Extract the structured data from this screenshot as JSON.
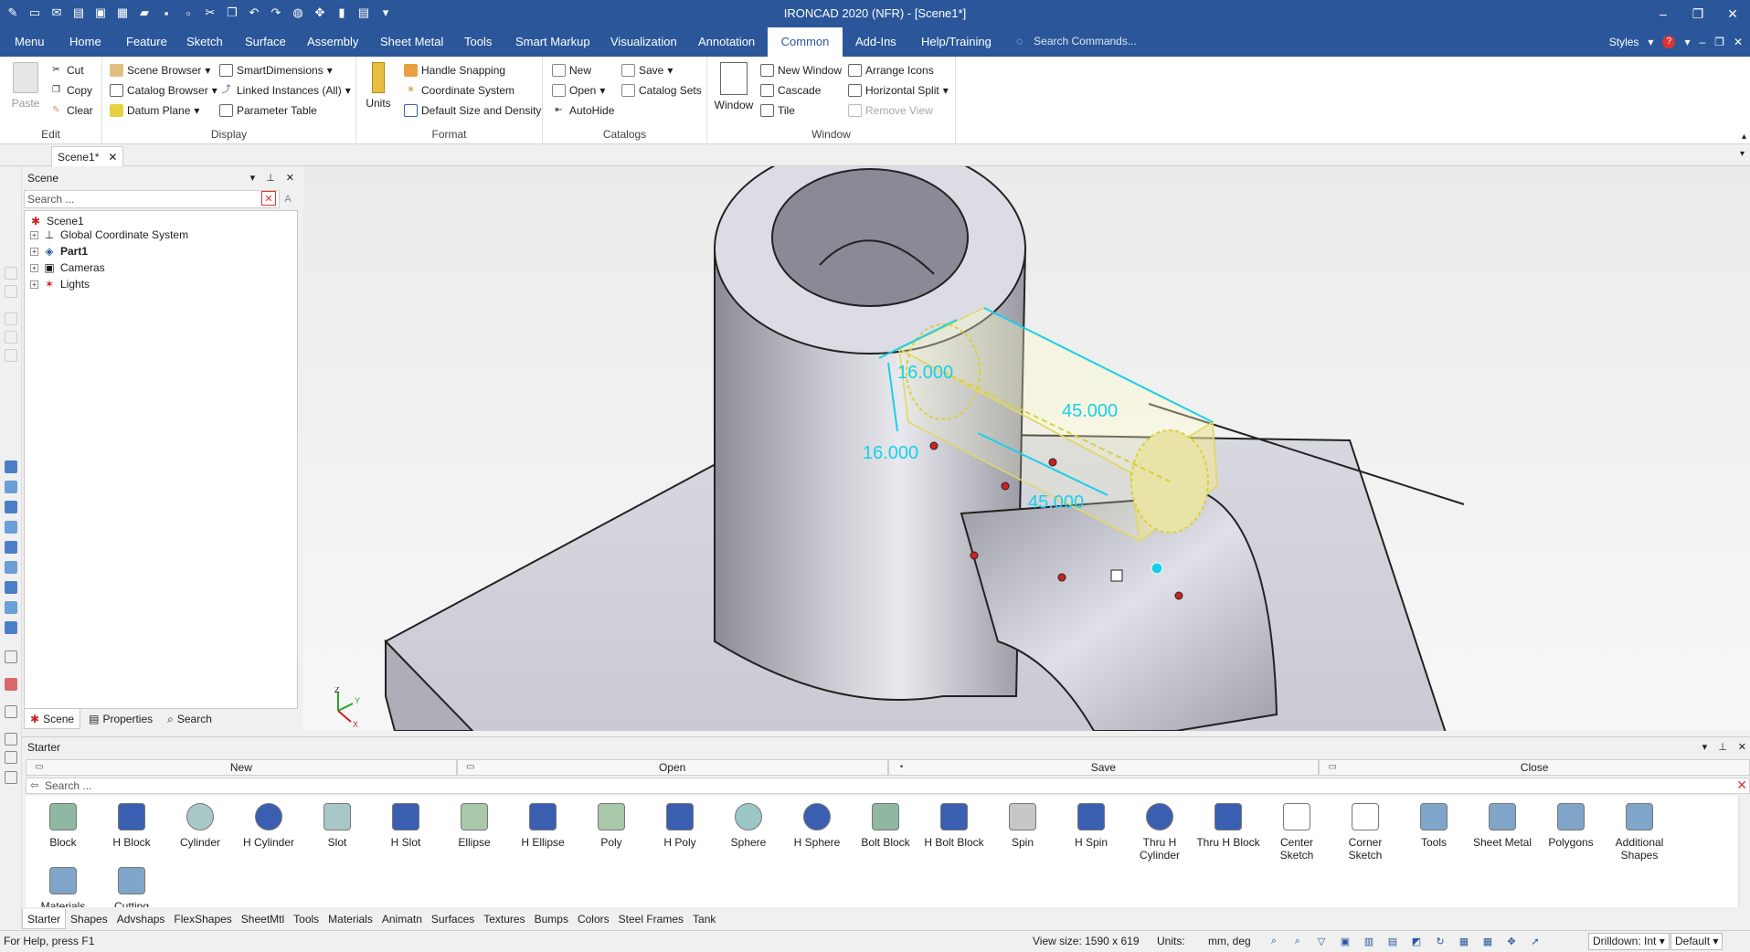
{
  "window": {
    "title": "IRONCAD 2020 (NFR) - [Scene1*]"
  },
  "ribbon_tabs": [
    "Menu",
    "Home",
    "Feature",
    "Sketch",
    "Surface",
    "Assembly",
    "Sheet Metal",
    "Tools",
    "Smart Markup",
    "Visualization",
    "Annotation",
    "Common",
    "Add-Ins",
    "Help/Training"
  ],
  "active_tab": "Common",
  "command_search_placeholder": "Search Commands...",
  "styles_label": "Styles",
  "ribbon": {
    "edit": {
      "title": "Edit",
      "paste": "Paste",
      "cut": "Cut",
      "copy": "Copy",
      "clear": "Clear"
    },
    "display": {
      "title": "Display",
      "scene_browser": "Scene Browser",
      "catalog_browser": "Catalog Browser",
      "datum_plane": "Datum Plane",
      "smart_dimensions": "SmartDimensions",
      "linked_instances": "Linked Instances (All)",
      "parameter_table": "Parameter Table"
    },
    "format": {
      "title": "Format",
      "units": "Units",
      "handle_snapping": "Handle Snapping",
      "coordinate_system": "Coordinate System",
      "default_size": "Default Size and Density"
    },
    "catalogs": {
      "title": "Catalogs",
      "new": "New",
      "open": "Open",
      "autohide": "AutoHide",
      "save": "Save",
      "catalog_sets": "Catalog Sets"
    },
    "window": {
      "title": "Window",
      "window": "Window",
      "new_window": "New Window",
      "cascade": "Cascade",
      "tile": "Tile",
      "arrange_icons": "Arrange Icons",
      "horizontal_split": "Horizontal Split",
      "remove_view": "Remove View"
    }
  },
  "doc_tab": "Scene1*",
  "scene_panel": {
    "title": "Scene",
    "search_placeholder": "Search ...",
    "tree": [
      {
        "label": "Scene1",
        "bold": false
      },
      {
        "label": "Global Coordinate System",
        "bold": false
      },
      {
        "label": "Part1",
        "bold": true
      },
      {
        "label": "Cameras",
        "bold": false
      },
      {
        "label": "Lights",
        "bold": false
      }
    ],
    "tabs": [
      "Scene",
      "Properties",
      "Search"
    ]
  },
  "viewport": {
    "dimensions": [
      "16.000",
      "45.000",
      "16.000",
      "45.000"
    ],
    "triad_labels": [
      "Z",
      "Y",
      "X"
    ]
  },
  "catalog": {
    "title": "Starter",
    "buttons": [
      "New",
      "Open",
      "Save",
      "Close"
    ],
    "search_placeholder": "Search ...",
    "items": [
      {
        "label": "Block",
        "color": "#8fb8a2"
      },
      {
        "label": "H Block",
        "color": "#3b5fb0"
      },
      {
        "label": "Cylinder",
        "color": "#a9c7c7"
      },
      {
        "label": "H Cylinder",
        "color": "#3b5fb0"
      },
      {
        "label": "Slot",
        "color": "#a9c7c7"
      },
      {
        "label": "H Slot",
        "color": "#3b5fb0"
      },
      {
        "label": "Ellipse",
        "color": "#a9c7a9"
      },
      {
        "label": "H Ellipse",
        "color": "#3b5fb0"
      },
      {
        "label": "Poly",
        "color": "#a9c7a9"
      },
      {
        "label": "H Poly",
        "color": "#3b5fb0"
      },
      {
        "label": "Sphere",
        "color": "#9cc7c7"
      },
      {
        "label": "H Sphere",
        "color": "#3b5fb0"
      },
      {
        "label": "Bolt Block",
        "color": "#8fb8a2"
      },
      {
        "label": "H Bolt Block",
        "color": "#3b5fb0"
      },
      {
        "label": "Spin",
        "color": "#c7c7c7"
      },
      {
        "label": "H Spin",
        "color": "#3b5fb0"
      },
      {
        "label": "Thru H Cylinder",
        "color": "#3b5fb0"
      },
      {
        "label": "Thru H Block",
        "color": "#3b5fb0"
      },
      {
        "label": "Center Sketch",
        "color": "#ffffff"
      },
      {
        "label": "Corner Sketch",
        "color": "#ffffff"
      },
      {
        "label": "Tools",
        "color": "#7fa6c9"
      },
      {
        "label": "Sheet Metal",
        "color": "#7fa6c9"
      },
      {
        "label": "Polygons",
        "color": "#7fa6c9"
      },
      {
        "label": "Additional Shapes",
        "color": "#7fa6c9"
      },
      {
        "label": "Materials",
        "color": "#7fa6c9"
      },
      {
        "label": "Cutting",
        "color": "#7fa6c9"
      }
    ],
    "tabs": [
      "Starter",
      "Shapes",
      "Advshaps",
      "FlexShapes",
      "SheetMtl",
      "Tools",
      "Materials",
      "Animatn",
      "Surfaces",
      "Textures",
      "Bumps",
      "Colors",
      "Steel Frames",
      "Tank"
    ]
  },
  "status": {
    "help": "For Help, press F1",
    "view_size": "View size: 1590 x  619",
    "units_label": "Units:",
    "units_value": "mm, deg",
    "drilldown": "Drilldown: Int",
    "default": "Default"
  },
  "colors": {
    "accent": "#2b579a",
    "dimension": "#19d0e8",
    "selection": "#e8e070"
  }
}
